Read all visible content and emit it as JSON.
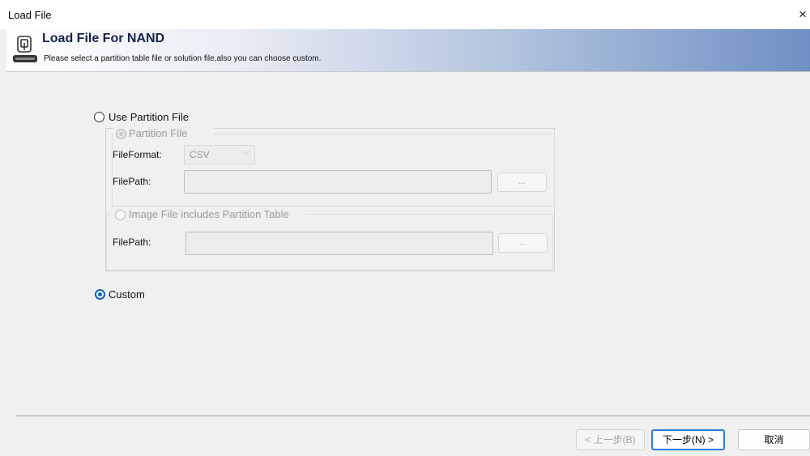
{
  "window": {
    "title": "Load File",
    "close_glyph": "×"
  },
  "header": {
    "title": "Load File For NAND",
    "subtitle": "Please select a partition table file or solution file,also you can choose custom.",
    "logo_icon": "dediprog-logo-icon"
  },
  "options": {
    "use_partition_file": {
      "label": "Use Partition File",
      "selected": false
    },
    "partition_file": {
      "label": "Partition File",
      "fileformat_label": "FileFormat:",
      "fileformat_value": "CSV",
      "filepath_label": "FilePath:",
      "filepath_value": "",
      "browse_label": "..."
    },
    "image_file": {
      "label": "Image File includes Partition Table",
      "filepath_label": "FilePath:",
      "filepath_value": "",
      "browse_label": "..."
    },
    "custom": {
      "label": "Custom",
      "selected": true
    }
  },
  "footer": {
    "back_label": "< 上一步(B)",
    "next_label": "下一步(N) >",
    "cancel_label": "取消"
  },
  "colors": {
    "accent": "#0a64c8",
    "header_gradient_end": "#6f90c4"
  }
}
